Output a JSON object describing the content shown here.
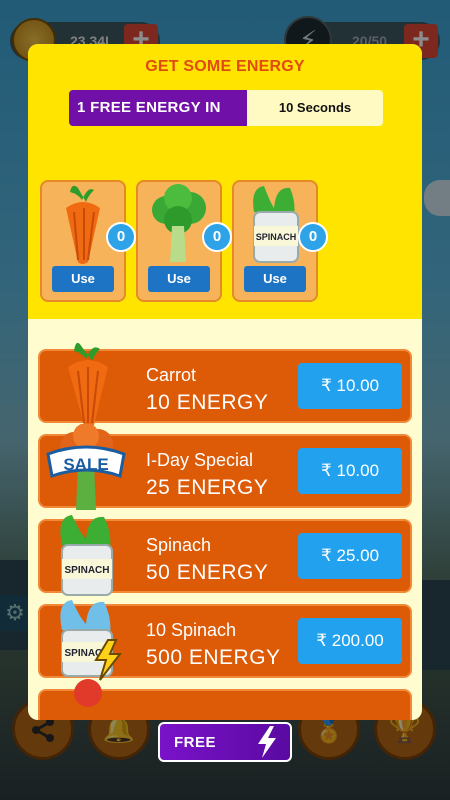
{
  "header": {
    "coins": "23.34L",
    "energy": "20/50",
    "coin_plus": "+",
    "energy_plus": "+"
  },
  "modal": {
    "title": "GET SOME ENERGY",
    "timer": {
      "label": "1  FREE ENERGY IN",
      "value": "10 Seconds"
    },
    "inventory": [
      {
        "item": "carrot",
        "count": "0",
        "button": "Use"
      },
      {
        "item": "broccoli",
        "count": "0",
        "button": "Use"
      },
      {
        "item": "spinach",
        "count": "0",
        "button": "Use"
      }
    ],
    "spinach_can_label": "SPINACH",
    "sale_label": "SALE",
    "offers": [
      {
        "name": "Carrot",
        "amount": "10 ENERGY",
        "price": "₹ 10.00",
        "icon": "carrot-icon"
      },
      {
        "name": "I-Day Special",
        "amount": "25 ENERGY",
        "price": "₹ 10.00",
        "icon": "sale-broccoli-icon"
      },
      {
        "name": "Spinach",
        "amount": "50 ENERGY",
        "price": "₹ 25.00",
        "icon": "spinach-can-icon"
      },
      {
        "name": "10 Spinach",
        "amount": "500 ENERGY",
        "price": "₹ 200.00",
        "icon": "spinach-pack-icon"
      }
    ]
  },
  "free_button": {
    "label": "FREE"
  },
  "colors": {
    "modal_header": "#ffe400",
    "modal_body": "#fffdd0",
    "title": "#e14b12",
    "timer_label_bg": "#7010a8",
    "offer_bg": "#dd5a06",
    "price_btn": "#22a2ee",
    "use_btn": "#1e74c4",
    "badge": "#2ea3e8"
  }
}
